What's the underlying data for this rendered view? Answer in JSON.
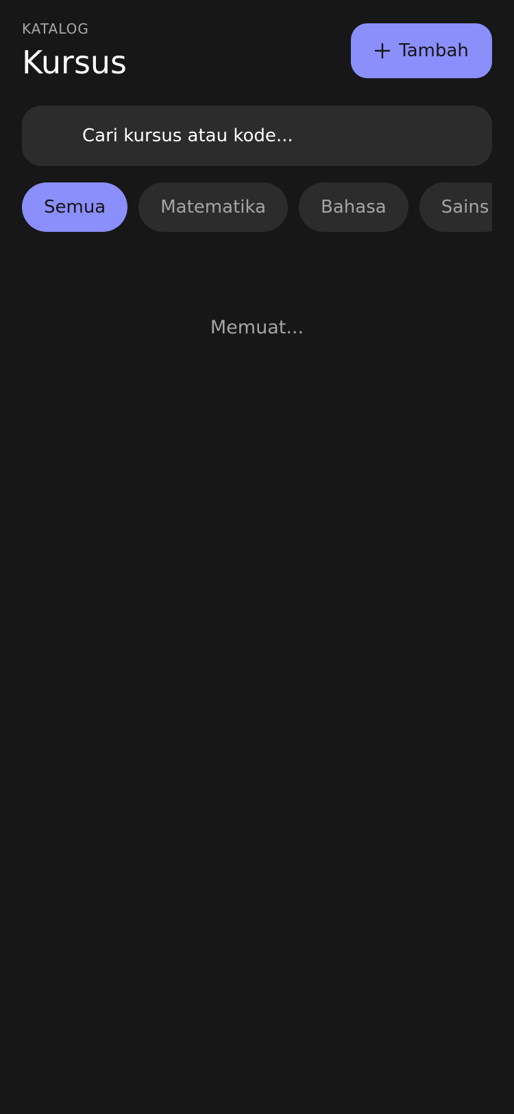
{
  "header": {
    "eyebrow": "KATALOG",
    "title": "Kursus",
    "add_button_label": "Tambah",
    "add_icon": "plus-icon"
  },
  "search": {
    "value": "",
    "placeholder": "Cari kursus atau kode..."
  },
  "filters": {
    "selected": "Semua",
    "items": [
      {
        "label": "Semua"
      },
      {
        "label": "Matematika"
      },
      {
        "label": "Bahasa"
      },
      {
        "label": "Sains"
      }
    ]
  },
  "status": {
    "loading_text": "Memuat..."
  },
  "colors": {
    "background": "#171717",
    "accent": "#8b8ffc",
    "surface": "#2c2c2c",
    "muted_text": "#a5a5a5"
  }
}
